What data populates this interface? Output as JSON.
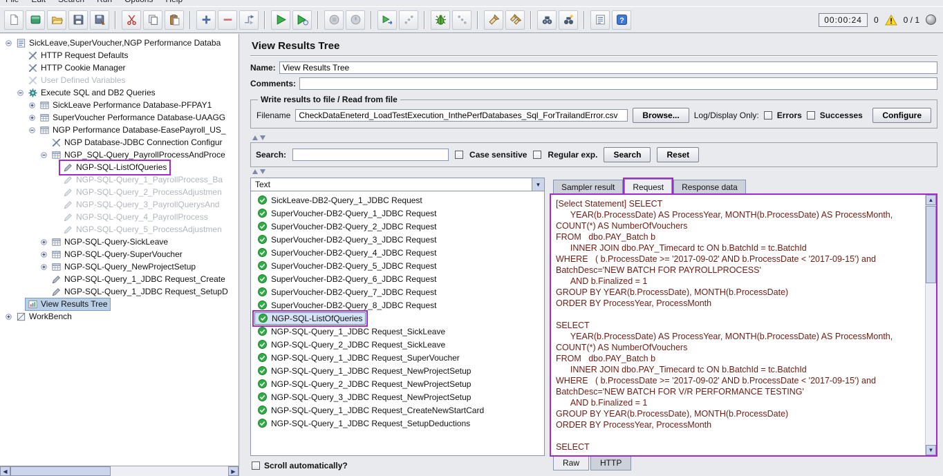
{
  "colors": {
    "annotation": "#a328cf",
    "tree_selection": "#b8cfe5",
    "list_selection_border": "#5f87c0",
    "sql_text": "#6b1d14",
    "success_green": "#2fae46",
    "warning_yellow": "#ffd734"
  },
  "menubar": {
    "items": [
      "File",
      "Edit",
      "Search",
      "Run",
      "Options",
      "Help"
    ]
  },
  "toolbar": {
    "groups": [
      [
        "new-file",
        "templates",
        "open-folder",
        "save",
        "save-as"
      ],
      [
        "cut",
        "copy",
        "paste"
      ],
      [
        "add",
        "remove",
        "toggle"
      ],
      [
        "start",
        "start-no-pauses"
      ],
      [
        "stop",
        "shutdown"
      ],
      [
        "remote-start",
        "remote-stop"
      ],
      [
        "debug",
        "debug-stop"
      ],
      [
        "clear",
        "clear-all"
      ],
      [
        "search",
        "search-reset"
      ],
      [
        "function-helper",
        "help"
      ]
    ],
    "timer": "00:00:24",
    "log_error_count": "0",
    "threads": "0 / 1"
  },
  "tree": {
    "items": [
      {
        "label": "SickLeave,SuperVoucher,NGP Performance Databa",
        "level": 0,
        "icon": "testplan",
        "handle": "expanded"
      },
      {
        "label": "HTTP Request Defaults",
        "level": 1,
        "icon": "wrench"
      },
      {
        "label": "HTTP Cookie Manager",
        "level": 1,
        "icon": "wrench"
      },
      {
        "label": "User Defined Variables",
        "level": 1,
        "icon": "wrench",
        "disabled": true
      },
      {
        "label": "Execute SQL and DB2 Queries",
        "level": 1,
        "icon": "gear",
        "handle": "expanded"
      },
      {
        "label": "SickLeave Performance Database-PFPAY1",
        "level": 2,
        "icon": "table",
        "handle": "collapsed"
      },
      {
        "label": "SuperVoucher Performance Database-UAAGG",
        "level": 2,
        "icon": "table",
        "handle": "collapsed"
      },
      {
        "label": "NGP Performance Database-EasePayroll_US_",
        "level": 2,
        "icon": "table",
        "handle": "expanded"
      },
      {
        "label": "NGP Database-JDBC Connection Configur",
        "level": 3,
        "icon": "wrench"
      },
      {
        "label": "NGP_SQL-Query_PayrollProcessAndProce",
        "level": 3,
        "icon": "table",
        "handle": "expanded"
      },
      {
        "label": "NGP-SQL-ListOfQueries",
        "level": 4,
        "icon": "pencil",
        "annotated": true
      },
      {
        "label": "NGP-SQL-Query_1_PayrollProcess_Ba",
        "level": 4,
        "icon": "pencil",
        "disabled": true
      },
      {
        "label": "NGP-SQL-Query_2_ProcessAdjustmen",
        "level": 4,
        "icon": "pencil",
        "disabled": true
      },
      {
        "label": "NGP-SQL-Query_3_PayrollQuerysAnd",
        "level": 4,
        "icon": "pencil",
        "disabled": true
      },
      {
        "label": "NGP-SQL-Query_4_PayrollProcess",
        "level": 4,
        "icon": "pencil",
        "disabled": true
      },
      {
        "label": "NGP-SQL-Query_5_ProcessAdjustmen",
        "level": 4,
        "icon": "pencil",
        "disabled": true
      },
      {
        "label": "NGP-SQL-Query-SickLeave",
        "level": 3,
        "icon": "table",
        "handle": "collapsed"
      },
      {
        "label": "NGP-SQL-Query-SuperVoucher",
        "level": 3,
        "icon": "table",
        "handle": "collapsed"
      },
      {
        "label": "NGP-SQL-Query_NewProjectSetup",
        "level": 3,
        "icon": "table",
        "handle": "collapsed"
      },
      {
        "label": "NGP-SQL-Query_1_JDBC Request_Create",
        "level": 3,
        "icon": "pencil"
      },
      {
        "label": "NGP-SQL-Query_1_JDBC Request_SetupD",
        "level": 3,
        "icon": "pencil"
      },
      {
        "label": "View Results Tree",
        "level": 1,
        "icon": "results",
        "selected": true
      },
      {
        "label": "WorkBench",
        "level": 0,
        "icon": "workbench",
        "handle": "collapsed"
      }
    ]
  },
  "main": {
    "title": "View Results Tree",
    "name_label": "Name:",
    "name_value": "View Results Tree",
    "comments_label": "Comments:",
    "comments_value": "",
    "file_group": {
      "title": "Write results to file / Read from file",
      "filename_label": "Filename",
      "filename_value": "CheckDataEneterd_LoadTestExecution_InthePerfDatabases_Sql_ForTrailandError.csv",
      "browse_button": "Browse...",
      "log_display_label": "Log/Display Only:",
      "errors_label": "Errors",
      "successes_label": "Successes",
      "configure_button": "Configure"
    },
    "search": {
      "label": "Search:",
      "value": "",
      "case_label": "Case sensitive",
      "regex_label": "Regular exp.",
      "search_button": "Search",
      "reset_button": "Reset"
    },
    "results": {
      "view_mode": "Text",
      "scroll_label": "Scroll automatically?",
      "items": [
        {
          "label": "SickLeave-DB2-Query_1_JDBC Request"
        },
        {
          "label": "SuperVoucher-DB2-Query_1_JDBC Request"
        },
        {
          "label": "SuperVoucher-DB2-Query_2_JDBC Request"
        },
        {
          "label": "SuperVoucher-DB2-Query_3_JDBC Request"
        },
        {
          "label": "SuperVoucher-DB2-Query_4_JDBC Request"
        },
        {
          "label": "SuperVoucher-DB2-Query_5_JDBC Request"
        },
        {
          "label": "SuperVoucher-DB2-Query_6_JDBC Request"
        },
        {
          "label": "SuperVoucher-DB2-Query_7_JDBC Request"
        },
        {
          "label": "SuperVoucher-DB2-Query_8_JDBC Request"
        },
        {
          "label": "NGP-SQL-ListOfQueries",
          "selected": true,
          "annotated": true
        },
        {
          "label": "NGP-SQL-Query_1_JDBC Request_SickLeave"
        },
        {
          "label": "NGP-SQL-Query_2_JDBC Request_SickLeave"
        },
        {
          "label": "NGP-SQL-Query_1_JDBC Request_SuperVoucher"
        },
        {
          "label": "NGP-SQL-Query_1_JDBC Request_NewProjectSetup"
        },
        {
          "label": "NGP-SQL-Query_2_JDBC Request_NewProjectSetup"
        },
        {
          "label": "NGP-SQL-Query_3_JDBC Request_NewProjectSetup"
        },
        {
          "label": "NGP-SQL-Query_1_JDBC Request_CreateNewStartCard"
        },
        {
          "label": "NGP-SQL-Query_1_JDBC Request_SetupDeductions"
        }
      ]
    },
    "detail": {
      "tabs": [
        {
          "label": "Sampler result"
        },
        {
          "label": "Request",
          "active": true,
          "annotated": true
        },
        {
          "label": "Response data"
        }
      ],
      "bottom_tabs": [
        {
          "label": "Raw",
          "active": true
        },
        {
          "label": "HTTP"
        }
      ],
      "request_text": "[Select Statement] SELECT\n      YEAR(b.ProcessDate) AS ProcessYear, MONTH(b.ProcessDate) AS ProcessMonth,\nCOUNT(*) AS NumberOfVouchers\nFROM   dbo.PAY_Batch b\n      INNER JOIN dbo.PAY_Timecard tc ON b.BatchId = tc.BatchId\nWHERE   ( b.ProcessDate >= '2017-09-02' AND b.ProcessDate < '2017-09-15') and\nBatchDesc='NEW BATCH FOR PAYROLLPROCESS'\n      AND b.Finalized = 1\nGROUP BY YEAR(b.ProcessDate), MONTH(b.ProcessDate)\nORDER BY ProcessYear, ProcessMonth\n\nSELECT\n      YEAR(b.ProcessDate) AS ProcessYear, MONTH(b.ProcessDate) AS ProcessMonth,\nCOUNT(*) AS NumberOfVouchers\nFROM   dbo.PAY_Batch b\n      INNER JOIN dbo.PAY_Timecard tc ON b.BatchId = tc.BatchId\nWHERE   ( b.ProcessDate >= '2017-09-02' AND b.ProcessDate < '2017-09-15') and\nBatchDesc='NEW BATCH FOR V/R PERFORMANCE TESTING'\n      AND b.Finalized = 1\nGROUP BY YEAR(b.ProcessDate), MONTH(b.ProcessDate)\nORDER BY ProcessYear, ProcessMonth\n\nSELECT\n      YEAR(b.ProcessDate) AS ProcessYear, MONTH(b.ProcessDate) AS ProcessMonth,"
    }
  }
}
